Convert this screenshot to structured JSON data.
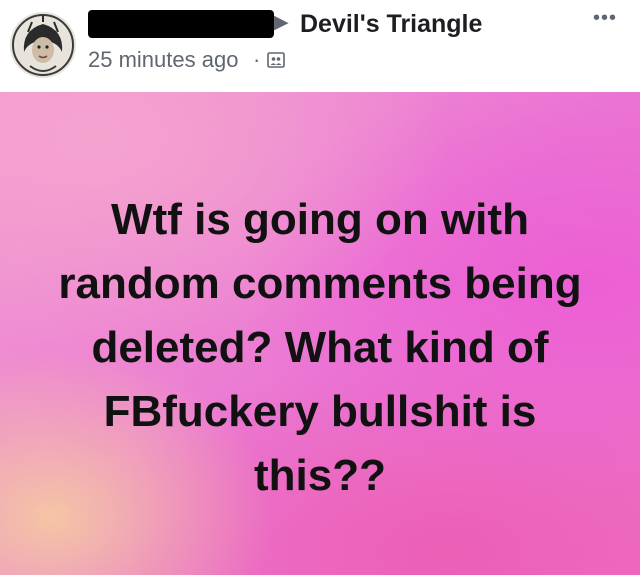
{
  "post": {
    "author": {
      "avatar_icon": "profile-avatar",
      "name_redacted": true
    },
    "share_arrow_icon": "arrow-right-icon",
    "group_name": "Devil's Triangle",
    "timestamp": "25 minutes ago",
    "separator": "·",
    "audience_icon": "group-audience-icon",
    "more_label": "•••",
    "status": "Wtf is going on with random comments being deleted? What kind of FBfuckery bullshit is this??",
    "background_colors": [
      "#f29ad1",
      "#ea77d3",
      "#ee70c4"
    ]
  }
}
